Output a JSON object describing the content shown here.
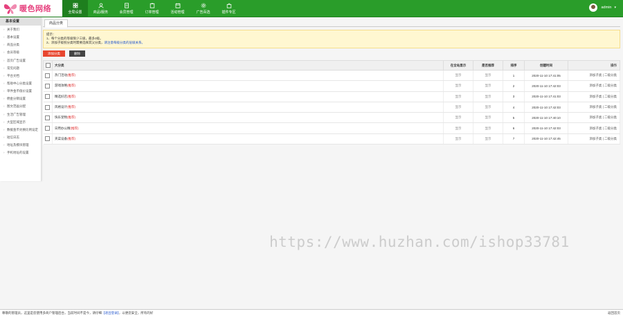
{
  "logo": {
    "text": "暖色网络"
  },
  "nav": [
    {
      "label": "全局设置",
      "icon": "grid-icon",
      "active": true
    },
    {
      "label": "商品/服务",
      "icon": "user-icon",
      "active": false
    },
    {
      "label": "会员管理",
      "icon": "document-icon",
      "active": false
    },
    {
      "label": "订单管理",
      "icon": "clipboard-icon",
      "active": false
    },
    {
      "label": "活动管理",
      "icon": "calendar-icon",
      "active": false
    },
    {
      "label": "广告百选",
      "icon": "gear-icon",
      "active": false
    },
    {
      "label": "插件专区",
      "icon": "bag-icon",
      "active": false
    }
  ],
  "user": {
    "name": "admin",
    "caret": "▾"
  },
  "sidebar": {
    "title": "基本设置",
    "items": [
      "关于我们",
      "基本设置",
      "商品分类",
      "会员等级",
      "首页广告设置",
      "常见问题",
      "平台文档",
      "帮助中心分类设置",
      "单件金币值价设置",
      "佣金分销设置",
      "图文范画分配",
      "生活广告管理",
      "大型区域显示",
      "数据金币兑换比例设定",
      "短信日志",
      "地址及模块管理",
      "手机地址的设置"
    ]
  },
  "tab": {
    "label": "商品分类"
  },
  "notice": {
    "title": "提示：",
    "line1": "1、每个分类的等级限少三级，最多3级。",
    "line2_prefix": "2、添加子级别分类时需要选择其父分类，",
    "line2_link": "请注意每级分类的层级关系。"
  },
  "buttons": {
    "add": "添加分类",
    "delete": "删除"
  },
  "table": {
    "headers": [
      "大分类",
      "在全站显示",
      "是否推荐",
      "排序",
      "创建时间",
      "操作"
    ],
    "hot_label": "(推荐)",
    "rows": [
      {
        "name": "热门活动",
        "show": "显示",
        "rec": "显示",
        "order": "1",
        "time": "2020-11-10 17:41:05",
        "ops": "添加子类 | 二级分类"
      },
      {
        "name": "游戏攻略",
        "show": "显示",
        "rec": "显示",
        "order": "2",
        "time": "2020-11-10 17:42:03",
        "ops": "添加子类 | 二级分类"
      },
      {
        "name": "精选好店",
        "show": "显示",
        "rec": "显示",
        "order": "3",
        "time": "2020-11-10 17:41:03",
        "ops": "添加子类 | 二级分类"
      },
      {
        "name": "风格设计",
        "show": "显示",
        "rec": "显示",
        "order": "4",
        "time": "2020-11-10 17:42:03",
        "ops": "添加子类 | 二级分类"
      },
      {
        "name": "快乐宠物",
        "show": "显示",
        "rec": "显示",
        "order": "5",
        "time": "2020-11-10 17:40:10",
        "ops": "添加子类 | 二级分类"
      },
      {
        "name": "日用办公精",
        "show": "显示",
        "rec": "显示",
        "order": "6",
        "time": "2020-11-10 17:42:03",
        "ops": "添加子类 | 二级分类"
      },
      {
        "name": "夹菜设备",
        "show": "显示",
        "rec": "显示",
        "order": "7",
        "time": "2020-11-10 17:42:45",
        "ops": "添加子类 | 二级分类"
      }
    ]
  },
  "watermark": "https://www.huzhan.com/ishop33781",
  "status": {
    "left_text": "尊敬的管理员，这里是您使用多商户管理后台，当前时间不是今，请仔细",
    "link_text": "【退出登录】",
    "tail_text": "，以便您安全，所有的好",
    "right_text": "返回首页"
  },
  "colors": {
    "brand_green": "#2a9d2a",
    "accent_red": "#e8462f"
  }
}
